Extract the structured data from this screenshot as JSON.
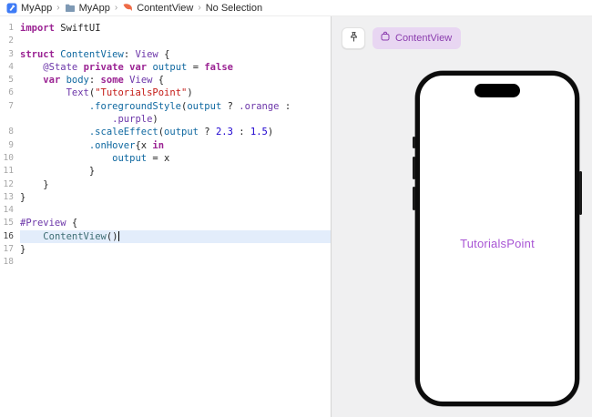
{
  "breadcrumb": {
    "separator": "›",
    "items": [
      {
        "icon": "app-icon",
        "label": "MyApp"
      },
      {
        "icon": "folder-icon",
        "label": "MyApp"
      },
      {
        "icon": "swift-file-icon",
        "label": "ContentView"
      },
      {
        "icon": "",
        "label": "No Selection"
      }
    ]
  },
  "editor": {
    "language": "swift",
    "rows": [
      {
        "num": "1",
        "segs": [
          [
            "k",
            "import"
          ],
          [
            "p",
            " SwiftUI"
          ]
        ]
      },
      {
        "num": "2",
        "segs": []
      },
      {
        "num": "3",
        "segs": [
          [
            "k",
            "struct"
          ],
          [
            "p",
            " "
          ],
          [
            "d",
            "ContentView"
          ],
          [
            "p",
            ": "
          ],
          [
            "t",
            "View"
          ],
          [
            "p",
            " {"
          ]
        ]
      },
      {
        "num": "4",
        "segs": [
          [
            "p",
            "    "
          ],
          [
            "t",
            "@State"
          ],
          [
            "p",
            " "
          ],
          [
            "k",
            "private"
          ],
          [
            "p",
            " "
          ],
          [
            "k",
            "var"
          ],
          [
            "p",
            " "
          ],
          [
            "d",
            "output"
          ],
          [
            "p",
            " = "
          ],
          [
            "k",
            "false"
          ]
        ]
      },
      {
        "num": "5",
        "segs": [
          [
            "p",
            "    "
          ],
          [
            "k",
            "var"
          ],
          [
            "p",
            " "
          ],
          [
            "d",
            "body"
          ],
          [
            "p",
            ": "
          ],
          [
            "k",
            "some"
          ],
          [
            "p",
            " "
          ],
          [
            "t",
            "View"
          ],
          [
            "p",
            " {"
          ]
        ]
      },
      {
        "num": "6",
        "segs": [
          [
            "p",
            "        "
          ],
          [
            "t",
            "Text"
          ],
          [
            "p",
            "("
          ],
          [
            "s",
            "\"TutorialsPoint\""
          ],
          [
            "p",
            ")"
          ]
        ]
      },
      {
        "num": "7",
        "segs": [
          [
            "p",
            "            "
          ],
          [
            "d",
            ".foregroundStyle"
          ],
          [
            "p",
            "("
          ],
          [
            "d",
            "output"
          ],
          [
            "p",
            " ? "
          ],
          [
            "t",
            ".orange"
          ],
          [
            "p",
            " :"
          ]
        ]
      },
      {
        "num": "",
        "segs": [
          [
            "p",
            "                "
          ],
          [
            "t",
            ".purple"
          ],
          [
            "p",
            ")"
          ]
        ]
      },
      {
        "num": "8",
        "segs": [
          [
            "p",
            "            "
          ],
          [
            "d",
            ".scaleEffect"
          ],
          [
            "p",
            "("
          ],
          [
            "d",
            "output"
          ],
          [
            "p",
            " ? "
          ],
          [
            "n",
            "2.3"
          ],
          [
            "p",
            " : "
          ],
          [
            "n",
            "1.5"
          ],
          [
            "p",
            ")"
          ]
        ]
      },
      {
        "num": "9",
        "segs": [
          [
            "p",
            "            "
          ],
          [
            "d",
            ".onHover"
          ],
          [
            "p",
            "{x "
          ],
          [
            "k",
            "in"
          ]
        ]
      },
      {
        "num": "10",
        "segs": [
          [
            "p",
            "                "
          ],
          [
            "d",
            "output"
          ],
          [
            "p",
            " = x"
          ]
        ]
      },
      {
        "num": "11",
        "segs": [
          [
            "p",
            "            }"
          ]
        ]
      },
      {
        "num": "12",
        "segs": [
          [
            "p",
            "    }"
          ]
        ]
      },
      {
        "num": "13",
        "segs": [
          [
            "p",
            "}"
          ]
        ]
      },
      {
        "num": "14",
        "segs": []
      },
      {
        "num": "15",
        "segs": [
          [
            "t",
            "#Preview"
          ],
          [
            "p",
            " {"
          ]
        ]
      },
      {
        "num": "16",
        "current": true,
        "cursor": true,
        "segs": [
          [
            "p",
            "    "
          ],
          [
            "pr",
            "ContentView"
          ],
          [
            "p",
            "()"
          ]
        ]
      },
      {
        "num": "17",
        "segs": [
          [
            "p",
            "}"
          ]
        ]
      },
      {
        "num": "18",
        "segs": []
      }
    ]
  },
  "canvas": {
    "pin_button": {
      "icon": "pin-icon"
    },
    "preview_tab": {
      "icon": "app-device-icon",
      "label": "ContentView"
    },
    "device": {
      "kind": "iphone",
      "screen_text": "TutorialsPoint"
    },
    "colors": {
      "canvas_bg": "#f0f0f1",
      "tab_bg": "#e8d6f2",
      "tab_text": "#8b3dae",
      "preview_text": "#a854d4",
      "phone_frame": "#0c0c0c"
    }
  },
  "syntax_colors": {
    "keyword": "#9b2393",
    "plain": "#262626",
    "type": "#6c36a9",
    "declaration": "#0f68a0",
    "project_type": "#3f6e74",
    "string": "#c41a16",
    "number": "#1c00cf",
    "line_number": "#a6a6a6",
    "current_line_bg": "#e3edfb"
  }
}
